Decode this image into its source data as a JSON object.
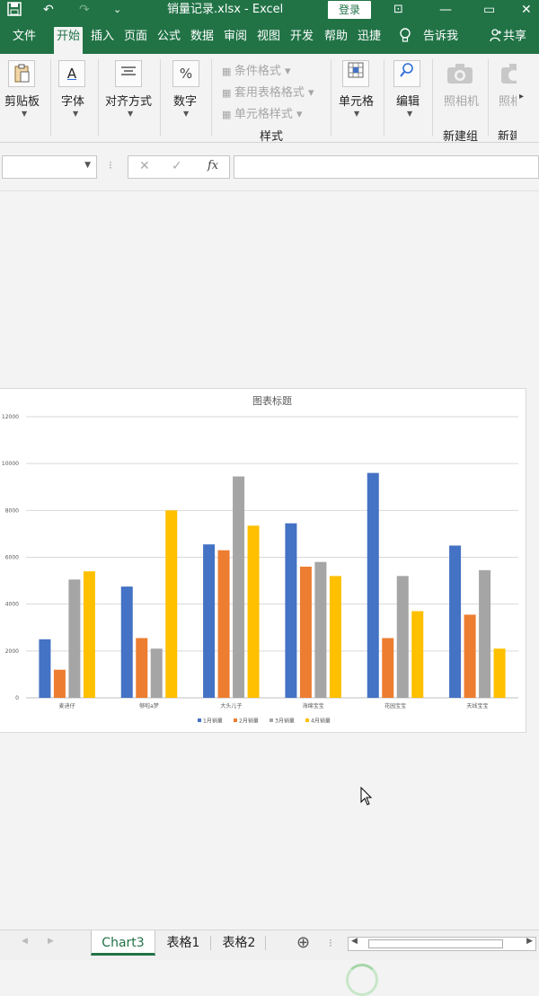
{
  "window": {
    "title": "销量记录.xlsx - Excel",
    "login": "登录",
    "qa_save": "💾",
    "qa_undo": "↶",
    "qa_redo": "↷",
    "qa_more": "⌄",
    "min": "—",
    "restore": "▭",
    "close": "✕",
    "opt": "⊡"
  },
  "tabs": [
    "文件",
    "开始",
    "插入",
    "页面布",
    "公式",
    "数据",
    "审阅",
    "视图",
    "开发工",
    "帮助",
    "迅捷PD"
  ],
  "active_tab": "开始",
  "tell_me": "告诉我",
  "share": "共享",
  "ribbon": {
    "clipboard": "剪贴板",
    "font": "字体",
    "align": "对齐方式",
    "number": "数字",
    "cond_format": "条件格式",
    "table_format": "套用表格格式",
    "cell_style": "单元格样式",
    "styles_group": "样式",
    "cells": "单元格",
    "edit": "编辑",
    "camera": "照相机",
    "new_group": "新建组",
    "camera2": "照相机",
    "new_group2": "新建",
    "icon_font": "A",
    "icon_number": "%"
  },
  "formula": {
    "cancel": "✕",
    "enter": "✓",
    "fx": "fx",
    "name_value": "",
    "formula_value": ""
  },
  "sheets": [
    "Chart3",
    "表格1",
    "表格2"
  ],
  "active_sheet": "Chart3",
  "add_sheet": "⊕",
  "colors": {
    "accent": "#217346",
    "s1": "#4472c4",
    "s2": "#ed7d31",
    "s3": "#a5a5a5",
    "s4": "#ffc000"
  },
  "chart_data": {
    "type": "bar",
    "title": "图表标题",
    "categories": [
      "麦迪仔",
      "够啦a梦",
      "大头儿子",
      "海绵宝宝",
      "花园宝宝",
      "天线宝宝"
    ],
    "series": [
      {
        "name": "1月销量",
        "values": [
          2500,
          4750,
          6550,
          7450,
          9600,
          6500
        ]
      },
      {
        "name": "2月销量",
        "values": [
          1200,
          2550,
          6300,
          5600,
          2550,
          3550
        ]
      },
      {
        "name": "3月销量",
        "values": [
          5050,
          2100,
          9450,
          5800,
          5200,
          5450
        ]
      },
      {
        "name": "4月销量",
        "values": [
          5400,
          8000,
          7350,
          5200,
          3700,
          2100
        ]
      }
    ],
    "yticks": [
      "0",
      "2000",
      "4000",
      "6000",
      "8000",
      "10000",
      "12000"
    ],
    "ylim": [
      0,
      12000
    ],
    "grid": true,
    "legend": "bottom"
  }
}
